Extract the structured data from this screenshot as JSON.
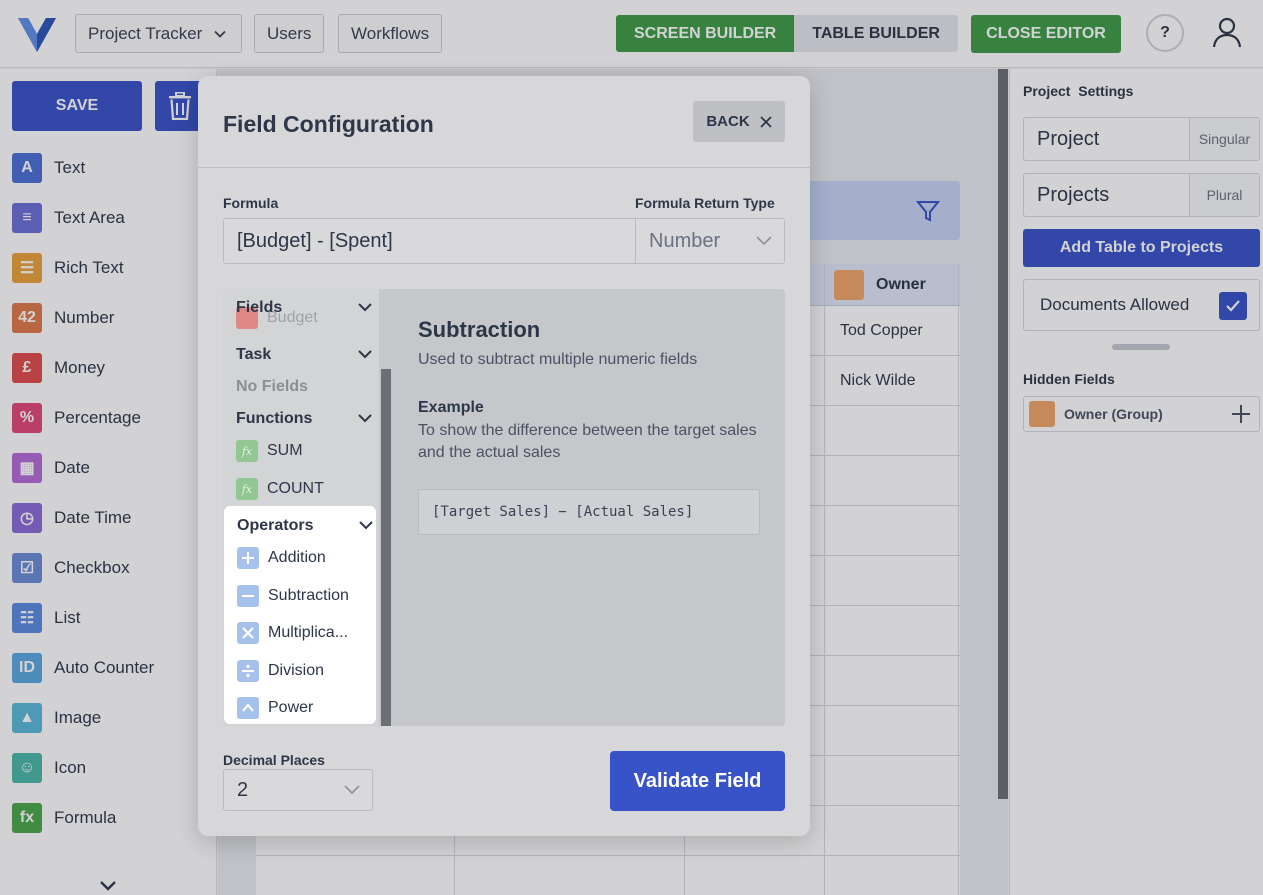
{
  "header": {
    "project_selector": "Project Tracker",
    "users_label": "Users",
    "workflows_label": "Workflows",
    "screen_builder_label": "SCREEN BUILDER",
    "table_builder_label": "TABLE BUILDER",
    "close_editor_label": "CLOSE EDITOR",
    "help_label": "?"
  },
  "sidebar": {
    "save_label": "SAVE",
    "field_types": [
      {
        "label": "Text",
        "glyph": "A",
        "color": "#4b6fd6"
      },
      {
        "label": "Text Area",
        "glyph": "≡",
        "color": "#6b6fd6"
      },
      {
        "label": "Rich Text",
        "glyph": "☰",
        "color": "#e8a23a"
      },
      {
        "label": "Number",
        "glyph": "42",
        "color": "#e07a4a"
      },
      {
        "label": "Money",
        "glyph": "£",
        "color": "#e04b4b"
      },
      {
        "label": "Percentage",
        "glyph": "%",
        "color": "#e0487a"
      },
      {
        "label": "Date",
        "glyph": "▦",
        "color": "#b46bd6"
      },
      {
        "label": "Date Time",
        "glyph": "◷",
        "color": "#8a6bd6"
      },
      {
        "label": "Checkbox",
        "glyph": "☑",
        "color": "#6b8ad6"
      },
      {
        "label": "List",
        "glyph": "☷",
        "color": "#5a8ae0"
      },
      {
        "label": "Auto Counter",
        "glyph": "ID",
        "color": "#5aa8e0"
      },
      {
        "label": "Image",
        "glyph": "▲",
        "color": "#5ab8d6"
      },
      {
        "label": "Icon",
        "glyph": "☺",
        "color": "#4ab8a8"
      },
      {
        "label": "Formula",
        "glyph": "fx",
        "color": "#4aa84a"
      }
    ]
  },
  "main": {
    "owner_header": "Owner",
    "rows": [
      "Tod Copper",
      "Nick Wilde"
    ]
  },
  "project_settings": {
    "title": "Project  Settings",
    "singular_value": "Project",
    "singular_suffix": "Singular",
    "plural_value": "Projects",
    "plural_suffix": "Plural",
    "add_table_label": "Add Table to Projects",
    "documents_label": "Documents Allowed",
    "documents_allowed": true,
    "hidden_fields_title": "Hidden Fields",
    "hidden_fields": [
      "Owner (Group)"
    ]
  },
  "modal": {
    "title": "Field Configuration",
    "back_label": "BACK",
    "formula_label": "Formula",
    "formula_value": "[Budget] - [Spent]",
    "return_type_label": "Formula Return Type",
    "return_type_value": "Number",
    "picker": {
      "groups": {
        "fields": "Fields",
        "fields_item": "Budget",
        "task": "Task",
        "task_empty": "No Fields",
        "functions": "Functions",
        "function_items": [
          "SUM",
          "COUNT"
        ],
        "operators": "Operators",
        "operator_items": [
          "Addition",
          "Subtraction",
          "Multiplica...",
          "Division",
          "Power"
        ]
      },
      "detail": {
        "title": "Subtraction",
        "description": "Used to subtract multiple numeric fields",
        "example_heading": "Example",
        "example_text": "To show the difference between the target sales and the actual sales",
        "example_code": "[Target Sales] − [Actual Sales]"
      }
    },
    "decimal_label": "Decimal Places",
    "decimal_value": "2",
    "validate_label": "Validate Field"
  }
}
